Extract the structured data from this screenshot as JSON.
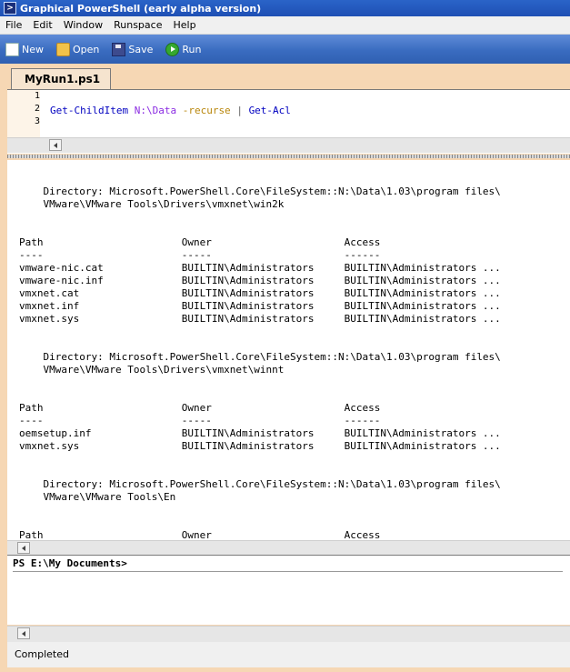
{
  "window": {
    "title": "Graphical PowerShell (early alpha version)",
    "icon": "powershell-icon"
  },
  "menu": [
    {
      "label": "File"
    },
    {
      "label": "Edit"
    },
    {
      "label": "Window"
    },
    {
      "label": "Runspace"
    },
    {
      "label": "Help"
    }
  ],
  "toolbar": {
    "new_label": "New",
    "open_label": "Open",
    "save_label": "Save",
    "run_label": "Run"
  },
  "editor": {
    "tab_label": "MyRun1.ps1",
    "line_numbers": [
      "1",
      "2",
      "3"
    ],
    "code": {
      "cmd1": "Get-ChildItem",
      "path": "N:\\Data",
      "param": "-recurse",
      "pipe": "|",
      "cmd2": "Get-Acl"
    }
  },
  "output": {
    "text": "\n\n    Directory: Microsoft.PowerShell.Core\\FileSystem::N:\\Data\\1.03\\program files\\\n    VMware\\VMware Tools\\Drivers\\vmxnet\\win2k\n\n\nPath                       Owner                      Access\n----                       -----                      ------\nvmware-nic.cat             BUILTIN\\Administrators     BUILTIN\\Administrators ...\nvmware-nic.inf             BUILTIN\\Administrators     BUILTIN\\Administrators ...\nvmxnet.cat                 BUILTIN\\Administrators     BUILTIN\\Administrators ...\nvmxnet.inf                 BUILTIN\\Administrators     BUILTIN\\Administrators ...\nvmxnet.sys                 BUILTIN\\Administrators     BUILTIN\\Administrators ...\n\n\n    Directory: Microsoft.PowerShell.Core\\FileSystem::N:\\Data\\1.03\\program files\\\n    VMware\\VMware Tools\\Drivers\\vmxnet\\winnt\n\n\nPath                       Owner                      Access\n----                       -----                      ------\noemsetup.inf               BUILTIN\\Administrators     BUILTIN\\Administrators ...\nvmxnet.sys                 BUILTIN\\Administrators     BUILTIN\\Administrators ...\n\n\n    Directory: Microsoft.PowerShell.Core\\FileSystem::N:\\Data\\1.03\\program files\\\n    VMware\\VMware Tools\\En\n\n\nPath                       Owner                      Access"
  },
  "console": {
    "prompt": "PS E:\\My Documents>"
  },
  "status": {
    "text": "Completed"
  }
}
